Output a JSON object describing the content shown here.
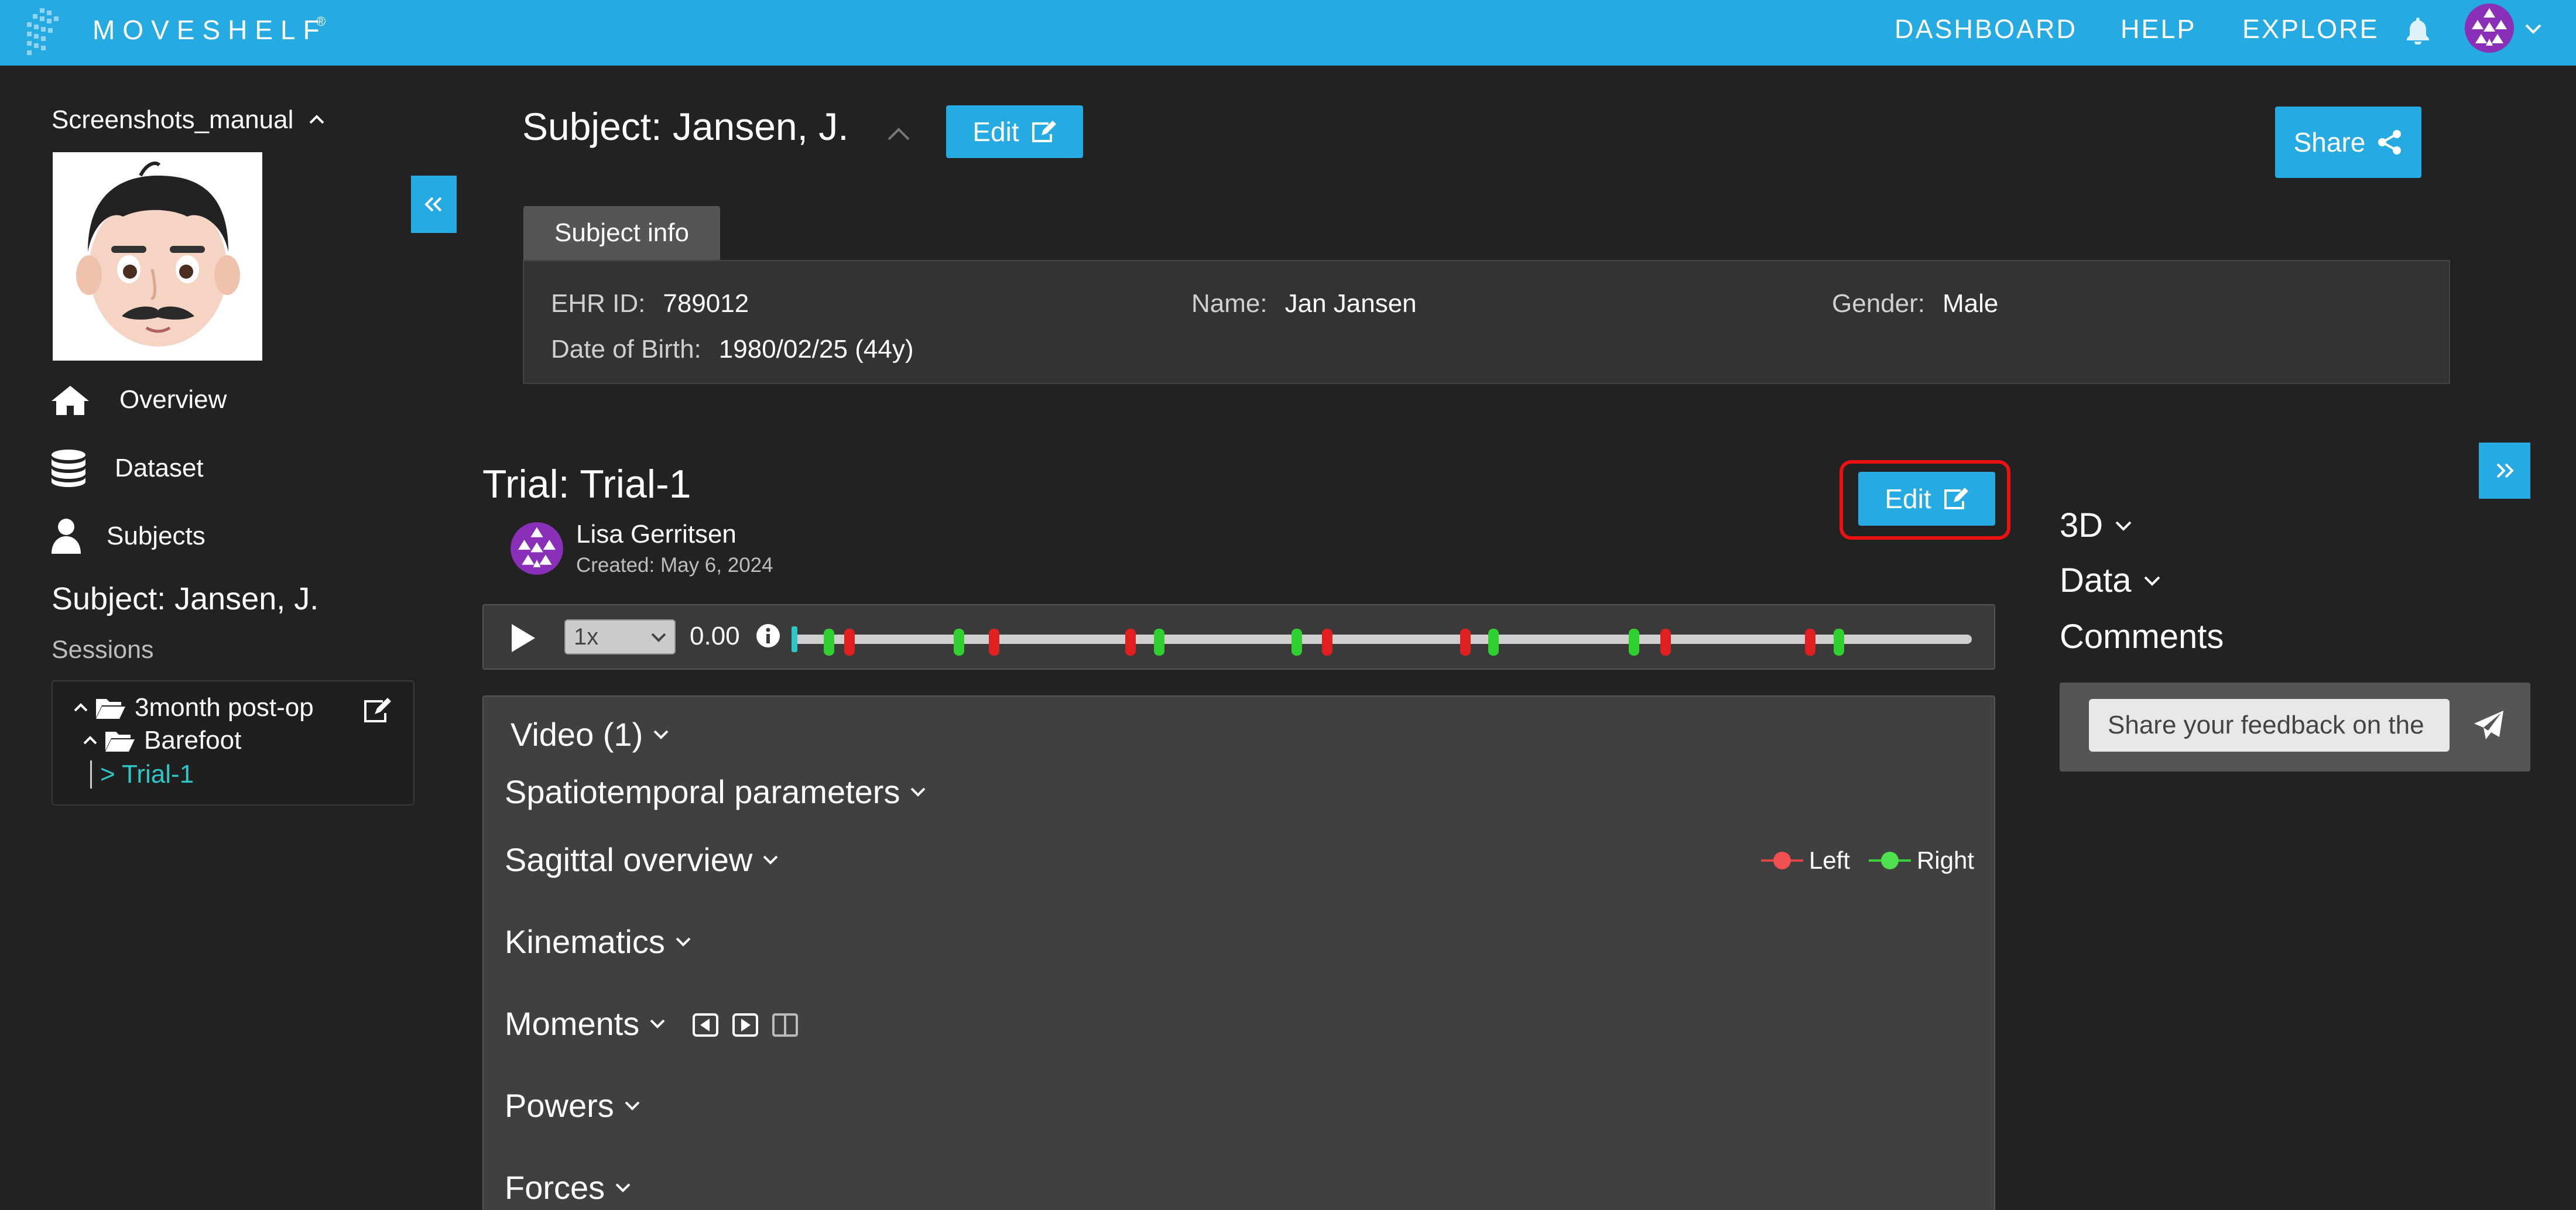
{
  "nav": {
    "brand": "MOVESHELF",
    "brand_mark": "®",
    "links": [
      "DASHBOARD",
      "HELP",
      "EXPLORE"
    ]
  },
  "sidebar": {
    "workspace": "Screenshots_manual",
    "items": [
      {
        "label": "Overview",
        "icon": "home-icon"
      },
      {
        "label": "Dataset",
        "icon": "database-icon"
      },
      {
        "label": "Subjects",
        "icon": "user-icon"
      }
    ],
    "subject_title": "Subject: Jansen, J.",
    "sessions_label": "Sessions",
    "tree": {
      "session": "3month post-op",
      "condition": "Barefoot",
      "trial": "> Trial-1"
    }
  },
  "subject": {
    "title": "Subject: Jansen, J.",
    "edit_label": "Edit",
    "share_label": "Share",
    "info_tab": "Subject info",
    "fields": {
      "ehr_key": "EHR ID:",
      "ehr_val": "789012",
      "name_key": "Name:",
      "name_val": "Jan Jansen",
      "gender_key": "Gender:",
      "gender_val": "Male",
      "dob_key": "Date of Birth:",
      "dob_val": "1980/02/25 (44y)"
    }
  },
  "trial": {
    "title": "Trial: Trial-1",
    "edit_label": "Edit",
    "owner": "Lisa Gerritsen",
    "created": "Created: May 6, 2024",
    "playback": {
      "speed": "1x",
      "time": "0.00",
      "progress": 0.0
    },
    "events": [
      {
        "pos": 0.03,
        "side": "right"
      },
      {
        "pos": 0.047,
        "side": "left"
      },
      {
        "pos": 0.14,
        "side": "right"
      },
      {
        "pos": 0.17,
        "side": "left"
      },
      {
        "pos": 0.286,
        "side": "left"
      },
      {
        "pos": 0.31,
        "side": "right"
      },
      {
        "pos": 0.427,
        "side": "right"
      },
      {
        "pos": 0.453,
        "side": "left"
      },
      {
        "pos": 0.57,
        "side": "left"
      },
      {
        "pos": 0.594,
        "side": "right"
      },
      {
        "pos": 0.713,
        "side": "right"
      },
      {
        "pos": 0.74,
        "side": "left"
      },
      {
        "pos": 0.863,
        "side": "left"
      },
      {
        "pos": 0.887,
        "side": "right"
      }
    ],
    "sections": {
      "video": "Video (1)",
      "spatio": "Spatiotemporal parameters",
      "sagittal": "Sagittal overview",
      "kinematics": "Kinematics",
      "moments": "Moments",
      "powers": "Powers",
      "forces": "Forces"
    },
    "legend": {
      "left": "Left",
      "right": "Right"
    }
  },
  "right_panel": {
    "sections": [
      "3D",
      "Data",
      "Comments"
    ],
    "comment_placeholder": "Share your feedback on the"
  },
  "colors": {
    "accent": "#25aae1",
    "left_event": "#e02020",
    "right_event": "#2fd02f",
    "selected_tree": "#2ec7c7"
  }
}
